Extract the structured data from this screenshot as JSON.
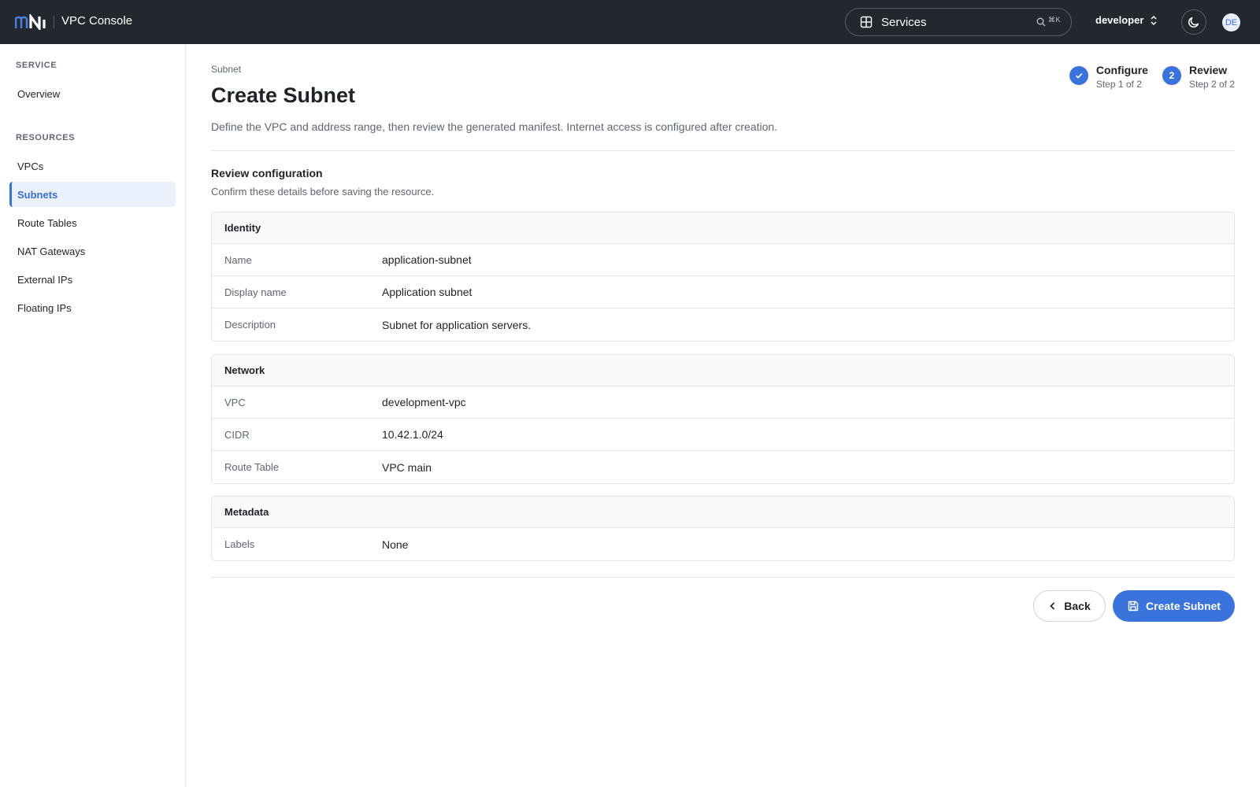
{
  "header": {
    "app_title": "VPC Console",
    "services_label": "Services",
    "shortcut": "⌘K",
    "project": "developer",
    "avatar_initials": "DE"
  },
  "sidebar": {
    "service_heading": "SERVICE",
    "service_items": [
      {
        "label": "Overview"
      }
    ],
    "resources_heading": "RESOURCES",
    "resource_items": [
      {
        "label": "VPCs",
        "active": false
      },
      {
        "label": "Subnets",
        "active": true
      },
      {
        "label": "Route Tables",
        "active": false
      },
      {
        "label": "NAT Gateways",
        "active": false
      },
      {
        "label": "External IPs",
        "active": false
      },
      {
        "label": "Floating IPs",
        "active": false
      }
    ]
  },
  "page": {
    "breadcrumb": "Subnet",
    "title": "Create Subnet",
    "description": "Define the VPC and address range, then review the generated manifest. Internet access is configured after creation."
  },
  "stepper": {
    "steps": [
      {
        "title": "Configure",
        "subtitle": "Step 1 of 2",
        "status": "complete"
      },
      {
        "number": "2",
        "title": "Review",
        "subtitle": "Step 2 of 2",
        "status": "current"
      }
    ]
  },
  "review": {
    "title": "Review configuration",
    "subtitle": "Confirm these details before saving the resource.",
    "identity": {
      "title": "Identity",
      "rows": [
        {
          "key": "Name",
          "value": "application-subnet"
        },
        {
          "key": "Display name",
          "value": "Application subnet"
        },
        {
          "key": "Description",
          "value": "Subnet for application servers."
        }
      ]
    },
    "network": {
      "title": "Network",
      "rows": [
        {
          "key": "VPC",
          "value": "development-vpc"
        },
        {
          "key": "CIDR",
          "value": "10.42.1.0/24"
        },
        {
          "key": "Route Table",
          "value": "VPC main"
        }
      ]
    },
    "metadata": {
      "title": "Metadata",
      "rows": [
        {
          "key": "Labels",
          "value": "None"
        }
      ]
    }
  },
  "actions": {
    "back_label": "Back",
    "create_label": "Create Subnet"
  },
  "colors": {
    "accent": "#3a73dc",
    "topbar": "#23272e"
  }
}
